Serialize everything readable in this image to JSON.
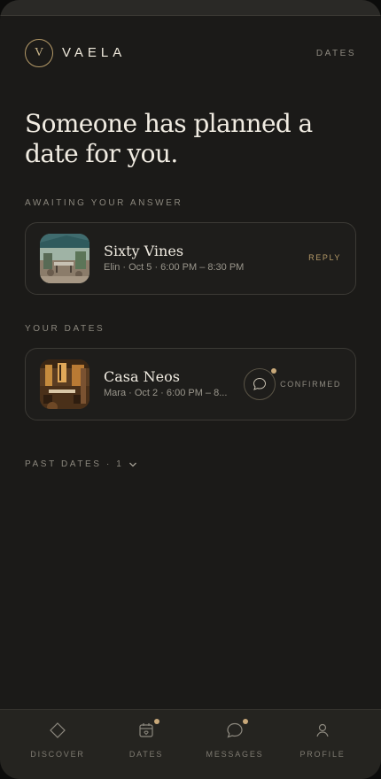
{
  "brand": {
    "mark": "V",
    "name": "VAELA"
  },
  "header": {
    "nav_link": "DATES"
  },
  "headline": "Someone has planned a date for you.",
  "awaiting": {
    "label": "AWAITING YOUR ANSWER",
    "card": {
      "title": "Sixty Vines",
      "subtitle": "Elin · Oct 5 · 6:00 PM – 8:30 PM",
      "action": "REPLY",
      "image": "restaurant-patio-photo"
    }
  },
  "your_dates": {
    "label": "YOUR DATES",
    "card": {
      "title": "Casa Neos",
      "subtitle": "Mara · Oct 2 · 6:00 PM – 8...",
      "status": "CONFIRMED",
      "image": "restaurant-interior-photo",
      "chat_icon": "chat-bubble-icon",
      "has_unread": true
    }
  },
  "past": {
    "label": "PAST DATES · 1",
    "icon": "chevron-down-icon"
  },
  "nav": {
    "items": [
      {
        "label": "DISCOVER",
        "icon": "diamond-icon",
        "badge": false
      },
      {
        "label": "DATES",
        "icon": "calendar-icon",
        "badge": true
      },
      {
        "label": "MESSAGES",
        "icon": "chat-bubble-icon",
        "badge": true
      },
      {
        "label": "PROFILE",
        "icon": "person-icon",
        "badge": false
      }
    ]
  },
  "colors": {
    "background": "#1b1a18",
    "accent": "#b59a68",
    "text": "#f1ece2",
    "muted": "#8c887e"
  }
}
